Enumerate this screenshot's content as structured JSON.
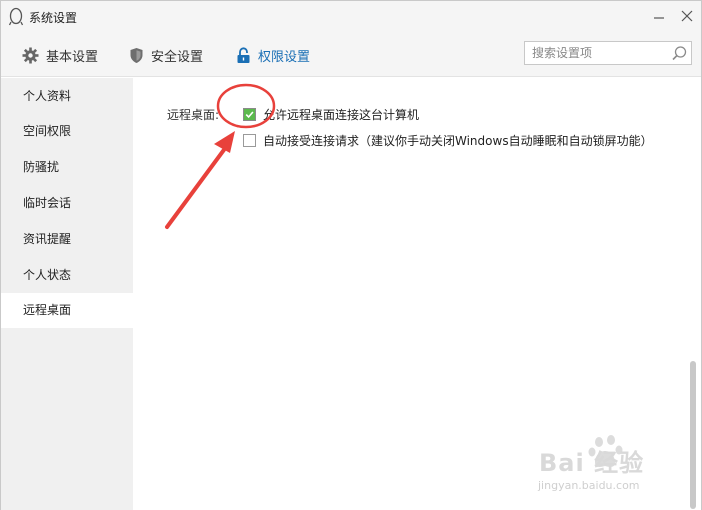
{
  "window": {
    "title": "系统设置"
  },
  "toolbar": {
    "tabs": [
      {
        "label": "基本设置",
        "icon": "gear-icon",
        "active": false
      },
      {
        "label": "安全设置",
        "icon": "shield-icon",
        "active": false
      },
      {
        "label": "权限设置",
        "icon": "lock-icon",
        "active": true
      }
    ],
    "search": {
      "placeholder": "搜索设置项",
      "value": ""
    }
  },
  "sidebar": {
    "items": [
      {
        "label": "个人资料",
        "active": false
      },
      {
        "label": "空间权限",
        "active": false
      },
      {
        "label": "防骚扰",
        "active": false
      },
      {
        "label": "临时会话",
        "active": false
      },
      {
        "label": "资讯提醒",
        "active": false
      },
      {
        "label": "个人状态",
        "active": false
      },
      {
        "label": "远程桌面",
        "active": true
      }
    ]
  },
  "content": {
    "section_label": "远程桌面:",
    "options": [
      {
        "label": "允许远程桌面连接这台计算机",
        "checked": true
      },
      {
        "label": "自动接受连接请求（建议你手动关闭Windows自动睡眠和自动锁屏功能）",
        "checked": false
      }
    ]
  },
  "colors": {
    "accent": "#1a6fb5",
    "check_green": "#5bb94d",
    "annotation_red": "#e8413b"
  },
  "watermark": {
    "main": "Bai 经验",
    "sub": "jingyan.baidu.com"
  }
}
